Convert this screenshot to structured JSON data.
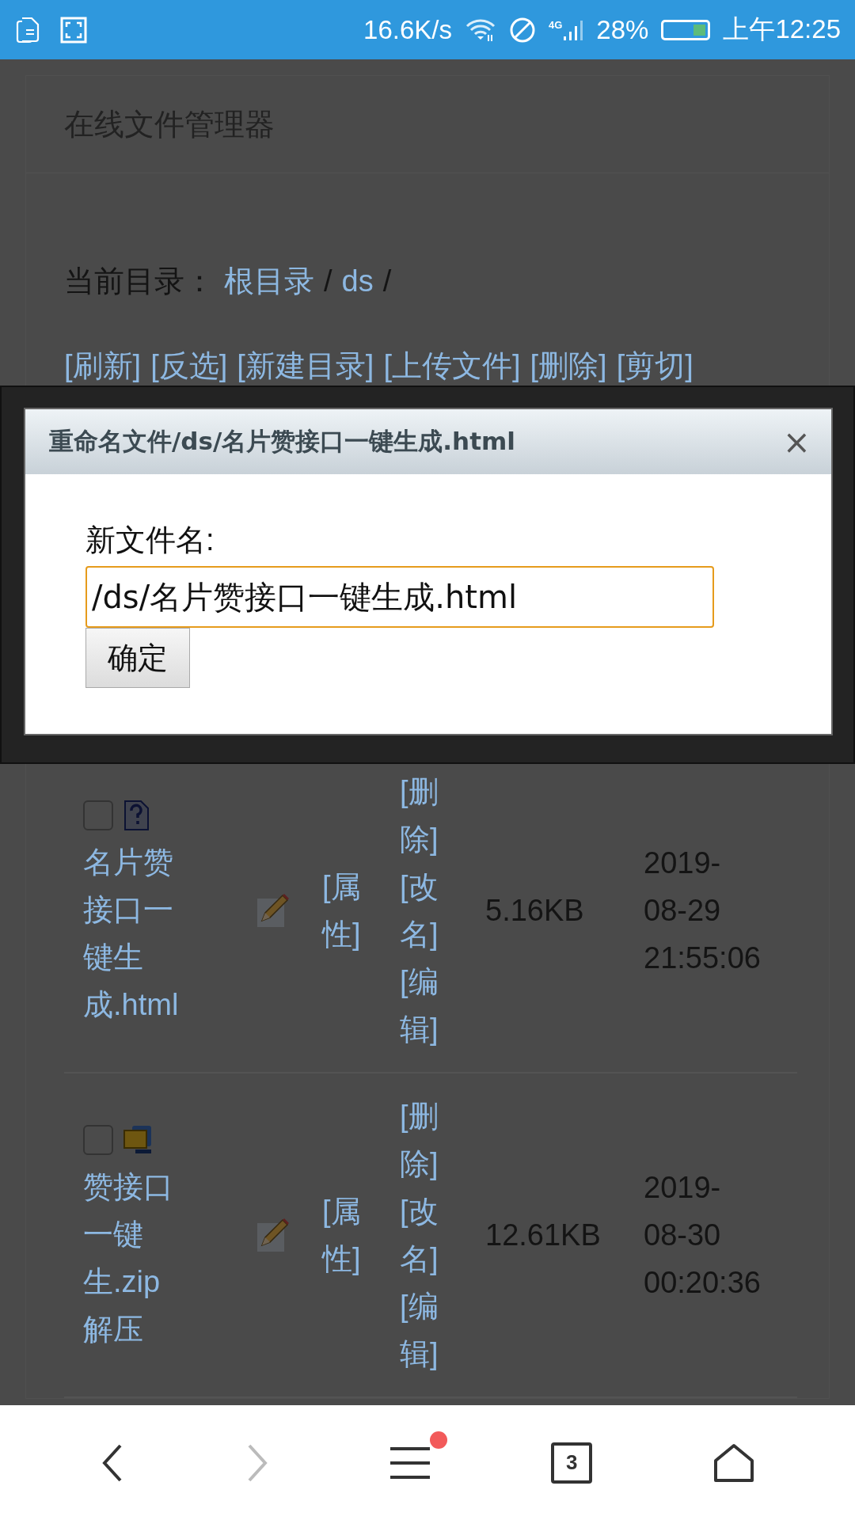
{
  "status_bar": {
    "speed": "16.6K/s",
    "network": "4G",
    "battery": "28%",
    "time": "上午12:25"
  },
  "page": {
    "title": "在线文件管理器",
    "path_label": "当前目录：",
    "separator": "/",
    "breadcrumbs": [
      "根目录",
      "ds"
    ],
    "actions": [
      "[刷新]",
      "[反选]",
      "[新建目录]",
      "[上传文件]",
      "[删除]",
      "[剪切]"
    ],
    "rows": [
      {
        "checked": false,
        "kind": "unknown",
        "name": "名片赞接口一键生成.html",
        "props": "[属性]",
        "ops": [
          "[删除]",
          "[改名]",
          "[编辑]"
        ],
        "size": "5.16KB",
        "modified": "2019-08-29 21:55:06"
      },
      {
        "checked": false,
        "kind": "archive",
        "name": "赞接口一键生.zip解压",
        "props": "[属性]",
        "ops": [
          "[删除]",
          "[改名]",
          "[编辑]"
        ],
        "size": "12.61KB",
        "modified": "2019-08-30 00:20:36"
      }
    ]
  },
  "dialog": {
    "title": "重命名文件/ds/名片赞接口一键生成.html",
    "close": "×",
    "label": "新文件名:",
    "value": "/ds/名片赞接口一键生成.html",
    "button": "确定"
  },
  "nav": {
    "tabs_count": "3",
    "menu_badge": true
  }
}
